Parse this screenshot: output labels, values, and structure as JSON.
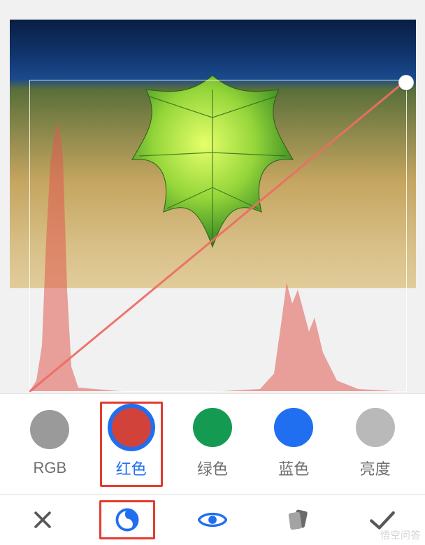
{
  "channels": [
    {
      "id": "rgb",
      "label": "RGB",
      "color": "#9a9a9a",
      "selected": false
    },
    {
      "id": "red",
      "label": "红色",
      "color": "#d0423a",
      "selected": true
    },
    {
      "id": "green",
      "label": "绿色",
      "color": "#159a52",
      "selected": false
    },
    {
      "id": "blue",
      "label": "蓝色",
      "color": "#1f6ff0",
      "selected": false
    },
    {
      "id": "luminance",
      "label": "亮度",
      "color": "#b9b9b9",
      "selected": false
    }
  ],
  "actions": {
    "cancel": {
      "name": "cancel"
    },
    "curves": {
      "name": "curves",
      "selected": true
    },
    "preview": {
      "name": "preview"
    },
    "cards": {
      "name": "style-cards"
    },
    "confirm": {
      "name": "confirm"
    }
  },
  "colors": {
    "accent_blue": "#1f6ff0",
    "highlight_red": "#e23b2e",
    "icon_gray": "#6b6b6b"
  },
  "watermark": "悟空问答"
}
